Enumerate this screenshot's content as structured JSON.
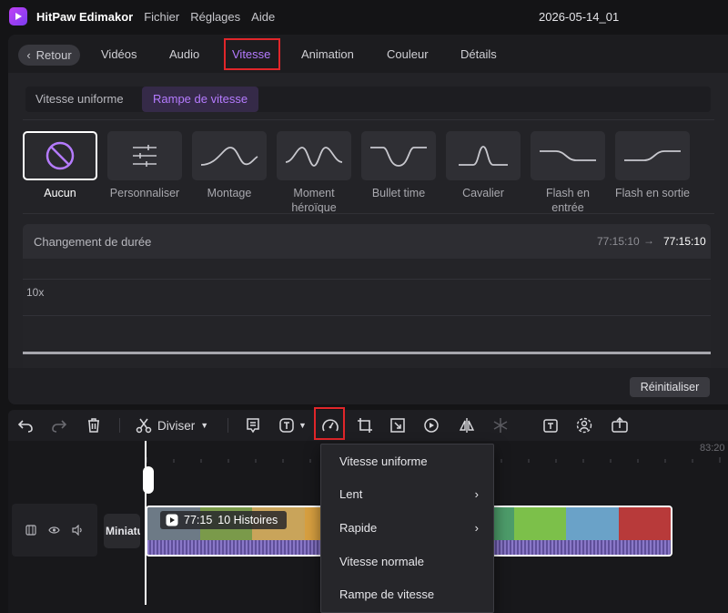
{
  "app": {
    "title": "HitPaw Edimakor",
    "project_name": "2026-05-14_01"
  },
  "menu": [
    "Fichier",
    "Réglages",
    "Aide"
  ],
  "tabs": {
    "back_label": "Retour",
    "items": [
      "Vidéos",
      "Audio",
      "Vitesse",
      "Animation",
      "Couleur",
      "Détails"
    ],
    "active": "Vitesse"
  },
  "speed_modes": {
    "uniform": "Vitesse uniforme",
    "ramp": "Rampe de vitesse",
    "active": "Rampe de vitesse"
  },
  "presets": [
    {
      "label": "Aucun",
      "icon": "no-icon",
      "selected": true
    },
    {
      "label": "Personnaliser",
      "icon": "sliders-icon"
    },
    {
      "label": "Montage",
      "icon": "montage-curve-icon"
    },
    {
      "label": "Moment héroïque",
      "icon": "hero-moment-curve-icon"
    },
    {
      "label": "Bullet time",
      "icon": "bullet-time-curve-icon"
    },
    {
      "label": "Cavalier",
      "icon": "jumper-curve-icon"
    },
    {
      "label": "Flash en entrée",
      "icon": "flash-in-curve-icon"
    },
    {
      "label": "Flash en sortie",
      "icon": "flash-out-curve-icon"
    }
  ],
  "duration": {
    "label": "Changement de durée",
    "original": "77:15:10",
    "new": "77:15:10"
  },
  "graph": {
    "max_label": "10x"
  },
  "reset_label": "Réinitialiser",
  "toolbar": {
    "split_label": "Diviser",
    "icons": [
      "undo-icon",
      "redo-icon",
      "delete-icon",
      "scissors-icon",
      "subtitle-icon",
      "text-icon",
      "speed-icon",
      "crop-icon",
      "resize-icon",
      "reverse-icon",
      "mirror-icon",
      "freeze-icon",
      "text-template-icon",
      "face-icon",
      "export-frame-icon"
    ]
  },
  "timeline": {
    "ruler_end": "83:20",
    "thumb_label": "Miniature",
    "clip": {
      "duration": "77:15",
      "title": "10 Histoires"
    }
  },
  "speed_menu": {
    "items": [
      {
        "label": "Vitesse uniforme",
        "submenu": false
      },
      {
        "label": "Lent",
        "submenu": true
      },
      {
        "label": "Rapide",
        "submenu": true
      },
      {
        "label": "Vitesse normale",
        "submenu": false
      },
      {
        "label": "Rampe de vitesse",
        "submenu": false
      }
    ]
  },
  "colors": {
    "accent": "#b57bff",
    "highlight": "#e0262a",
    "brand": "#c041f5"
  }
}
